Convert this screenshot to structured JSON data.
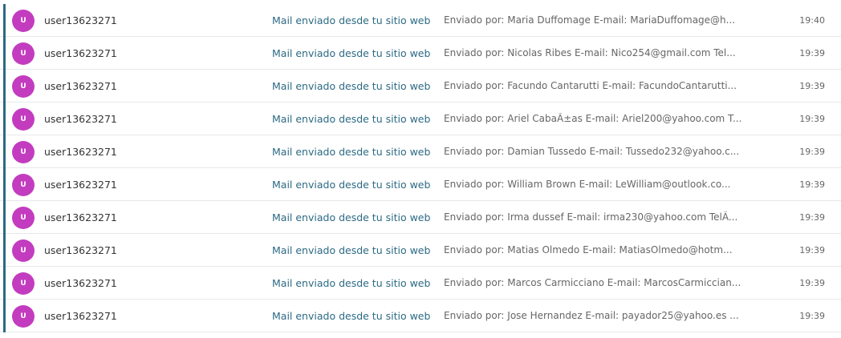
{
  "colors": {
    "accent": "#2c6a84",
    "avatar": "#c33cbf",
    "border": "#e6e8ea"
  },
  "messages": [
    {
      "avatar": "U",
      "sender": "user13623271",
      "subject": "Mail enviado desde tu sitio web",
      "preview": "Enviado por: Maria Duffomage E-mail: MariaDuffomage@h...",
      "time": "19:40"
    },
    {
      "avatar": "U",
      "sender": "user13623271",
      "subject": "Mail enviado desde tu sitio web",
      "preview": "Enviado por: Nicolas Ribes E-mail: Nico254@gmail.com Tel...",
      "time": "19:39"
    },
    {
      "avatar": "U",
      "sender": "user13623271",
      "subject": "Mail enviado desde tu sitio web",
      "preview": "Enviado por: Facundo Cantarutti E-mail: FacundoCantarutti...",
      "time": "19:39"
    },
    {
      "avatar": "U",
      "sender": "user13623271",
      "subject": "Mail enviado desde tu sitio web",
      "preview": "Enviado por: Ariel CabaÃ±as E-mail: Ariel200@yahoo.com T...",
      "time": "19:39"
    },
    {
      "avatar": "U",
      "sender": "user13623271",
      "subject": "Mail enviado desde tu sitio web",
      "preview": "Enviado por: Damian Tussedo E-mail: Tussedo232@yahoo.c...",
      "time": "19:39"
    },
    {
      "avatar": "U",
      "sender": "user13623271",
      "subject": "Mail enviado desde tu sitio web",
      "preview": "Enviado por: William Brown E-mail: LeWilliam@outlook.co...",
      "time": "19:39"
    },
    {
      "avatar": "U",
      "sender": "user13623271",
      "subject": "Mail enviado desde tu sitio web",
      "preview": "Enviado por: Irma dussef E-mail: irma230@yahoo.com TelÃ...",
      "time": "19:39"
    },
    {
      "avatar": "U",
      "sender": "user13623271",
      "subject": "Mail enviado desde tu sitio web",
      "preview": "Enviado por: Matias Olmedo E-mail: MatiasOlmedo@hotm...",
      "time": "19:39"
    },
    {
      "avatar": "U",
      "sender": "user13623271",
      "subject": "Mail enviado desde tu sitio web",
      "preview": "Enviado por: Marcos Carmicciano E-mail: MarcosCarmiccian...",
      "time": "19:39"
    },
    {
      "avatar": "U",
      "sender": "user13623271",
      "subject": "Mail enviado desde tu sitio web",
      "preview": "Enviado por: Jose Hernandez E-mail: payador25@yahoo.es ...",
      "time": "19:39"
    }
  ]
}
